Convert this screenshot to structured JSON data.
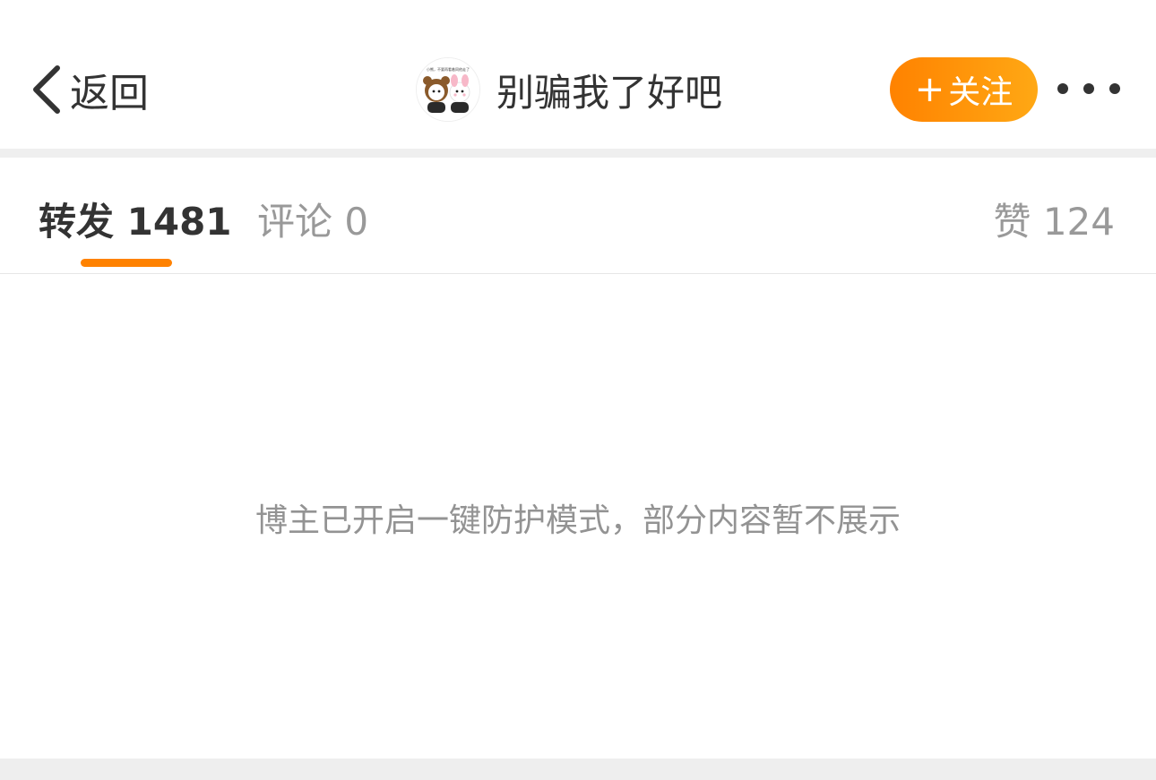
{
  "header": {
    "back_label": "返回",
    "title": "别骗我了好吧",
    "follow_label": "关注",
    "follow_plus": "+",
    "avatar_caption": "小熊，不要再看着同他走了"
  },
  "tabs": {
    "repost": "转发 1481",
    "comment": "评论 0",
    "like": "赞 124"
  },
  "content": {
    "notice": "博主已开启一键防护模式，部分内容暂不展示"
  },
  "colors": {
    "accent": "#ff8200",
    "muted_text": "#939393",
    "divider": "#efefef"
  },
  "icons": [
    "back-chevron-icon",
    "more-dots-icon",
    "avatar-image"
  ]
}
